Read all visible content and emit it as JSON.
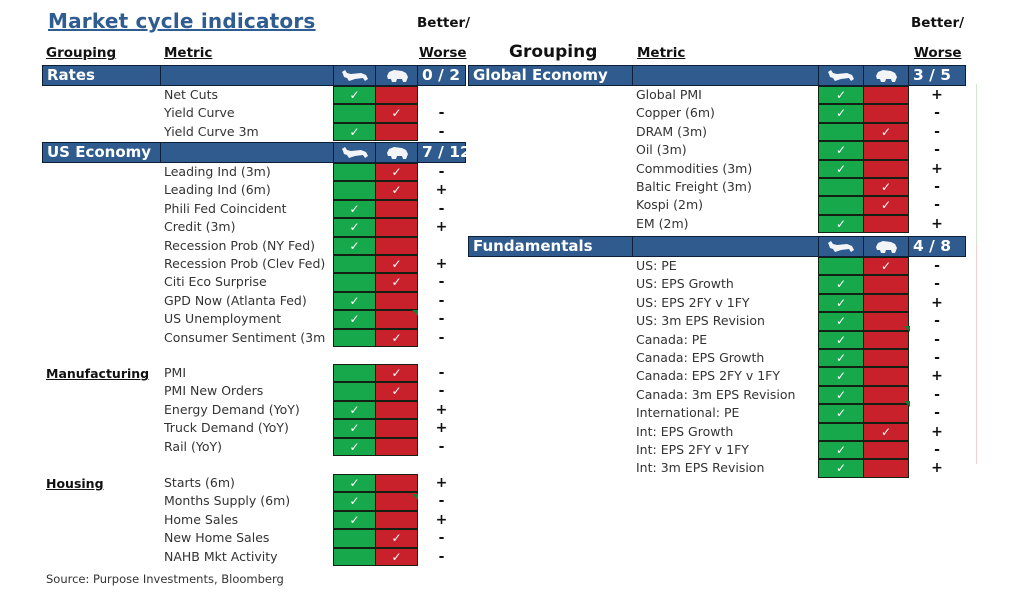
{
  "title": "Market cycle indicators",
  "source": "Source: Purpose Investments, Bloomberg",
  "headers": {
    "grouping": "Grouping",
    "metric": "Metric",
    "better": "Better/",
    "worse": "Worse"
  },
  "colors": {
    "header_blue": "#2f5b8f",
    "bull_green": "#17a84b",
    "bear_red": "#c9212b",
    "title_blue": "#2f5d91"
  },
  "icons": {
    "bull": "bull-icon",
    "bear": "bear-icon",
    "check": "✓"
  },
  "left": {
    "sections": [
      {
        "name": "Rates",
        "score": "0 / 2",
        "style": "bar",
        "rows": [
          {
            "metric": "Net Cuts",
            "signal": "bull",
            "change": ""
          },
          {
            "metric": "Yield Curve",
            "signal": "bear",
            "change": "-"
          },
          {
            "metric": "Yield Curve 3m",
            "signal": "bull",
            "change": "-"
          }
        ]
      },
      {
        "name": "US Economy",
        "score": "7 / 12",
        "style": "bar",
        "rows": [
          {
            "metric": "Leading Ind (3m)",
            "signal": "bear",
            "change": "-"
          },
          {
            "metric": "Leading Ind (6m)",
            "signal": "bear",
            "change": "+"
          },
          {
            "metric": "Phili Fed Coincident",
            "signal": "bull",
            "change": "-"
          },
          {
            "metric": "Credit (3m)",
            "signal": "bull",
            "change": "+"
          },
          {
            "metric": "Recession Prob (NY Fed)",
            "signal": "bull",
            "change": ""
          },
          {
            "metric": "Recession Prob (Clev Fed)",
            "signal": "bear",
            "change": "+"
          },
          {
            "metric": "Citi Eco Surprise",
            "signal": "bear",
            "change": "-"
          },
          {
            "metric": "GPD Now (Atlanta Fed)",
            "signal": "bull",
            "change": "-"
          },
          {
            "metric": "US Unemployment",
            "signal": "bull",
            "change": "-"
          },
          {
            "metric": "Consumer Sentiment (3m",
            "signal": "bear",
            "change": "-"
          }
        ]
      },
      {
        "name": "Manufacturing",
        "score": "",
        "style": "label",
        "rows": [
          {
            "metric": "PMI",
            "signal": "bear",
            "change": "-"
          },
          {
            "metric": "PMI New Orders",
            "signal": "bear",
            "change": "-"
          },
          {
            "metric": "Energy Demand (YoY)",
            "signal": "bull",
            "change": "+"
          },
          {
            "metric": "Truck Demand (YoY)",
            "signal": "bull",
            "change": "+"
          },
          {
            "metric": "Rail (YoY)",
            "signal": "bull",
            "change": "-"
          }
        ]
      },
      {
        "name": "Housing",
        "score": "",
        "style": "label",
        "rows": [
          {
            "metric": "Starts (6m)",
            "signal": "bull",
            "change": "+"
          },
          {
            "metric": "Months Supply (6m)",
            "signal": "bull",
            "change": "-"
          },
          {
            "metric": "Home Sales",
            "signal": "bull",
            "change": "+"
          },
          {
            "metric": "New Home Sales",
            "signal": "bear",
            "change": "-"
          },
          {
            "metric": "NAHB Mkt Activity",
            "signal": "bear",
            "change": "-"
          }
        ]
      }
    ]
  },
  "right": {
    "sections": [
      {
        "name": "Global Economy",
        "score": "3 / 5",
        "style": "bar",
        "rows": [
          {
            "metric": "Global PMI",
            "signal": "bull",
            "change": "+"
          },
          {
            "metric": "Copper (6m)",
            "signal": "bull",
            "change": "-"
          },
          {
            "metric": "DRAM (3m)",
            "signal": "bear",
            "change": "-"
          },
          {
            "metric": "Oil (3m)",
            "signal": "bull",
            "change": "-"
          },
          {
            "metric": "Commodities (3m)",
            "signal": "bull",
            "change": "+"
          },
          {
            "metric": "Baltic Freight (3m)",
            "signal": "bear",
            "change": "-"
          },
          {
            "metric": "Kospi (2m)",
            "signal": "bear",
            "change": "-"
          },
          {
            "metric": "EM (2m)",
            "signal": "bull",
            "change": "+"
          }
        ]
      },
      {
        "name": "Fundamentals",
        "score": "4 / 8",
        "style": "bar",
        "rows": [
          {
            "metric": "US: PE",
            "signal": "bear",
            "change": "-"
          },
          {
            "metric": "US: EPS Growth",
            "signal": "bull",
            "change": "-"
          },
          {
            "metric": "US: EPS 2FY v 1FY",
            "signal": "bull",
            "change": "+"
          },
          {
            "metric": "US: 3m EPS Revision",
            "signal": "bull",
            "change": "-"
          },
          {
            "metric": "Canada: PE",
            "signal": "bull",
            "change": "-"
          },
          {
            "metric": "Canada: EPS Growth",
            "signal": "bull",
            "change": "-"
          },
          {
            "metric": "Canada: EPS 2FY v 1FY",
            "signal": "bull",
            "change": "+"
          },
          {
            "metric": "Canada: 3m EPS Revision",
            "signal": "bull",
            "change": "-"
          },
          {
            "metric": "International: PE",
            "signal": "bull",
            "change": "-"
          },
          {
            "metric": "Int: EPS Growth",
            "signal": "bear",
            "change": "+"
          },
          {
            "metric": "Int: EPS 2FY v 1FY",
            "signal": "bull",
            "change": "-"
          },
          {
            "metric": "Int: 3m EPS Revision",
            "signal": "bull",
            "change": "+"
          }
        ]
      }
    ]
  }
}
